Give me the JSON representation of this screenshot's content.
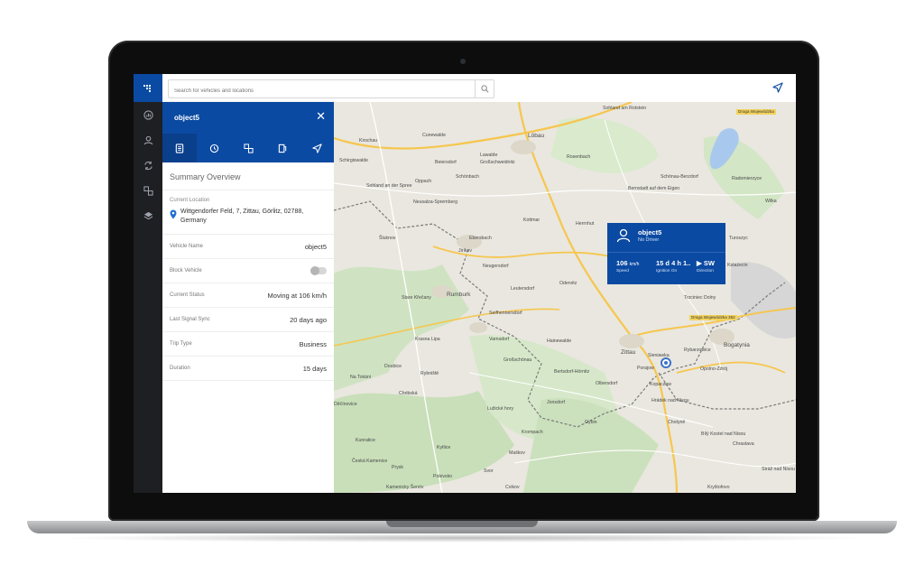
{
  "search": {
    "placeholder": "Search for vehicles and locations"
  },
  "rail": {
    "logo": "❙"
  },
  "panel": {
    "title": "object5",
    "close": "✕",
    "section_title": "Summary Overview",
    "location": {
      "label": "Current Location",
      "address": "Wittgendorfer Feld, 7, Zittau, Görlitz, 02788, Germany"
    },
    "fields": [
      {
        "label": "Vehicle Name",
        "value": "object5"
      },
      {
        "label": "Block Vehicle",
        "value": ""
      },
      {
        "label": "Current Status",
        "value": "Moving at 106 km/h"
      },
      {
        "label": "Last Signal Sync",
        "value": "20 days ago"
      },
      {
        "label": "Trip Type",
        "value": "Business"
      },
      {
        "label": "Duration",
        "value": "15 days"
      }
    ],
    "block_vehicle_on": false
  },
  "popup": {
    "name": "object5",
    "driver": "No Driver",
    "speed_value": "106",
    "speed_unit": "km/h",
    "speed_label": "Speed",
    "ignition_value": "15 d 4 h 1..",
    "ignition_label": "Ignition On",
    "direction_value": "▶ SW",
    "direction_label": "Direction"
  },
  "map_labels": [
    "Sohland am Rotstein",
    "Kirschau",
    "Cunewalde",
    "Löbau",
    "Schirgiswalde",
    "Beiersdorf",
    "Lawalde",
    "Großschweidnitz",
    "Rosenbach",
    "Schönau-Berzdorf",
    "Radomierzyce",
    "Sohland an der Spree",
    "Oppach",
    "Schönbach",
    "Bernstadt auf dem Eigen",
    "Wilka",
    "Neusalza-Spremberg",
    "Kottmar",
    "Herrnhut",
    "Ebersbach",
    "Jiríkov",
    "Neugersdorf",
    "Šluknov",
    "Leutersdorf",
    "Odervitz",
    "Kolażecin",
    "Stare Křečany",
    "Rumburk",
    "Seifhennersdorf",
    "Turoszyc",
    "Bogatynia",
    "Varnsdorf",
    "Hainewalde",
    "Zittau",
    "Sieniawka",
    "Porajow",
    "Rybarzowice",
    "Opolno-Zdrój",
    "Krasna Lipa",
    "Doubice",
    "Rybniště",
    "Großschönau",
    "Bertsdorf-Hörnitz",
    "Olbersdorf",
    "Kopaczow",
    "Na Tokáni",
    "Chribská",
    "Lužické hory",
    "Jonsdorf",
    "Hrádek nad Nisou",
    "Děčínovice",
    "Oybin",
    "Chotyně",
    "Krompach",
    "Bílý Kostel nad Nisou",
    "Chrastava",
    "Kunratice",
    "Kytlice",
    "Maškov",
    "Česká Kamenice",
    "Prysk",
    "Polevsko",
    "Svor",
    "Cvikov",
    "Kamenicky Šenóv",
    "Stráž nad Nisou",
    "Kryštofovo",
    "Trzciniec Dolny",
    "Droga Wojewódzka 352",
    "Droga Wojewódzka"
  ],
  "colors": {
    "brand": "#0b4aa2",
    "rail": "#1e1f22"
  }
}
